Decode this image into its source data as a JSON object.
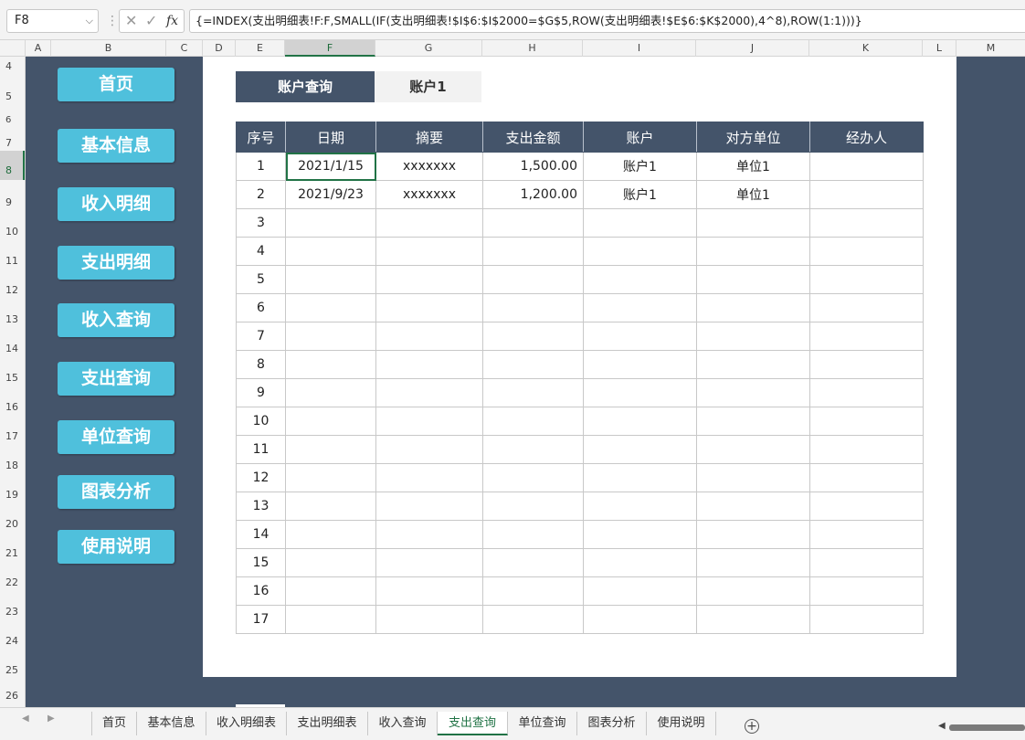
{
  "formula_bar": {
    "name_box": "F8",
    "fx_label": "fx",
    "formula": "{=INDEX(支出明细表!F:F,SMALL(IF(支出明细表!$I$6:$I$2000=$G$5,ROW(支出明细表!$E$6:$K$2000),4^8),ROW(1:1)))}"
  },
  "column_headers": [
    "A",
    "B",
    "C",
    "D",
    "E",
    "F",
    "G",
    "H",
    "I",
    "J",
    "K",
    "L",
    "M"
  ],
  "row_headers": [
    "4",
    "5",
    "6",
    "7",
    "8",
    "9",
    "10",
    "11",
    "12",
    "13",
    "14",
    "15",
    "16",
    "17",
    "18",
    "19",
    "20",
    "21",
    "22",
    "23",
    "24",
    "25",
    "26"
  ],
  "nav_buttons": [
    "首页",
    "基本信息",
    "收入明细",
    "支出明细",
    "收入查询",
    "支出查询",
    "单位查询",
    "图表分析",
    "使用说明"
  ],
  "query": {
    "title": "账户查询",
    "account": "账户1"
  },
  "table": {
    "headers": [
      "序号",
      "日期",
      "摘要",
      "支出金额",
      "账户",
      "对方单位",
      "经办人"
    ],
    "rows": [
      [
        "1",
        "2021/1/15",
        "xxxxxxx",
        "1,500.00",
        "账户1",
        "单位1",
        ""
      ],
      [
        "2",
        "2021/9/23",
        "xxxxxxx",
        "1,200.00",
        "账户1",
        "单位1",
        ""
      ],
      [
        "3",
        "",
        "",
        "",
        "",
        "",
        ""
      ],
      [
        "4",
        "",
        "",
        "",
        "",
        "",
        ""
      ],
      [
        "5",
        "",
        "",
        "",
        "",
        "",
        ""
      ],
      [
        "6",
        "",
        "",
        "",
        "",
        "",
        ""
      ],
      [
        "7",
        "",
        "",
        "",
        "",
        "",
        ""
      ],
      [
        "8",
        "",
        "",
        "",
        "",
        "",
        ""
      ],
      [
        "9",
        "",
        "",
        "",
        "",
        "",
        ""
      ],
      [
        "10",
        "",
        "",
        "",
        "",
        "",
        ""
      ],
      [
        "11",
        "",
        "",
        "",
        "",
        "",
        ""
      ],
      [
        "12",
        "",
        "",
        "",
        "",
        "",
        ""
      ],
      [
        "13",
        "",
        "",
        "",
        "",
        "",
        ""
      ],
      [
        "14",
        "",
        "",
        "",
        "",
        "",
        ""
      ],
      [
        "15",
        "",
        "",
        "",
        "",
        "",
        ""
      ],
      [
        "16",
        "",
        "",
        "",
        "",
        "",
        ""
      ],
      [
        "17",
        "",
        "",
        "",
        "",
        "",
        ""
      ]
    ]
  },
  "sheet_tabs": [
    "首页",
    "基本信息",
    "收入明细表",
    "支出明细表",
    "收入查询",
    "支出查询",
    "单位查询",
    "图表分析",
    "使用说明"
  ],
  "active_sheet": "支出查询",
  "colors": {
    "sheet_bg": "#44546a",
    "nav_button": "#4fc0dc",
    "excel_green": "#217346"
  }
}
